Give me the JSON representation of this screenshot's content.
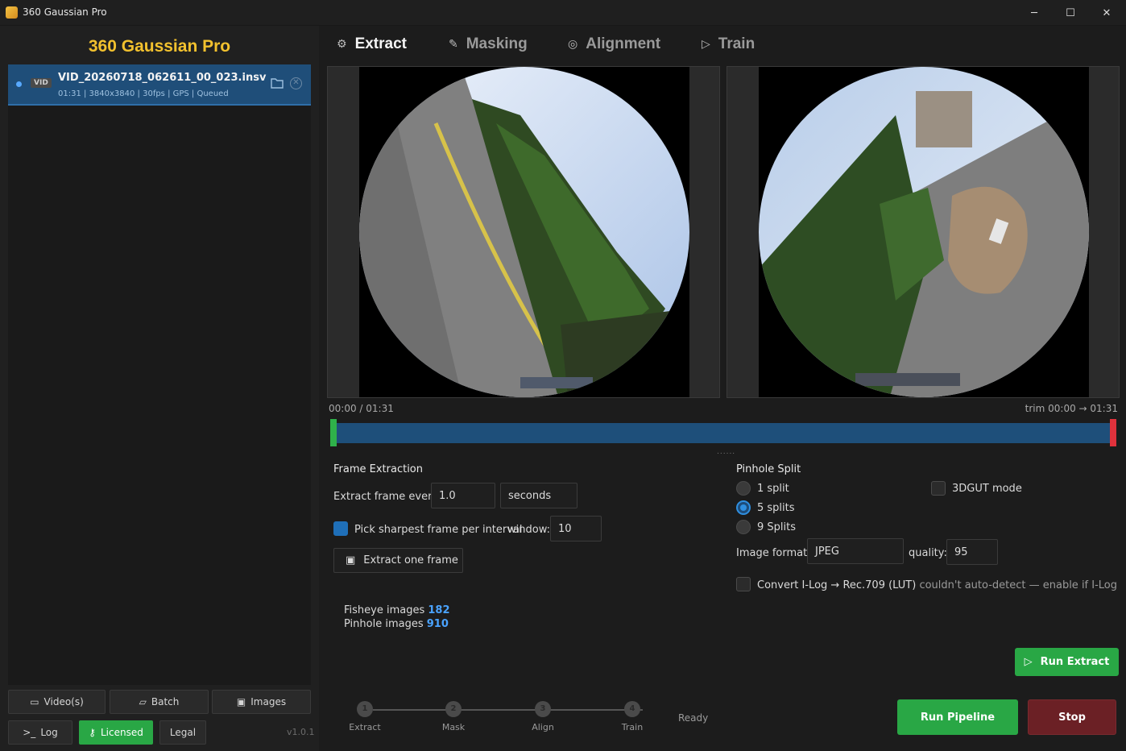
{
  "window": {
    "title": "360 Gaussian Pro",
    "minimize": "─",
    "maximize": "☐",
    "close": "✕"
  },
  "sidebar": {
    "brand": "360 Gaussian Pro",
    "files": [
      {
        "badge": "VID",
        "name": "VID_20260718_062611_00_023.insv",
        "meta": "01:31 | 3840x3840 | 30fps | GPS | Queued"
      }
    ],
    "buttons": {
      "videos": "Video(s)",
      "batch": "Batch",
      "images": "Images",
      "log": "Log",
      "licensed": "Licensed",
      "legal": "Legal"
    },
    "version": "v1.0.1"
  },
  "tabs": [
    {
      "label": "Extract",
      "icon": "gear-icon"
    },
    {
      "label": "Masking",
      "icon": "brush-icon"
    },
    {
      "label": "Alignment",
      "icon": "target-icon"
    },
    {
      "label": "Train",
      "icon": "play-icon"
    }
  ],
  "timeline": {
    "position": "00:00 / 01:31",
    "trim": "trim 00:00 → 01:31",
    "trim_start": 0.0,
    "trim_end": 1.0
  },
  "frame_extraction": {
    "title": "Frame Extraction",
    "every_label": "Extract frame every:",
    "every_value": "1.0",
    "unit": "seconds",
    "sharpest_label": "Pick sharpest frame per interval",
    "sharpest_checked": true,
    "window_label": "window:",
    "window_value": "10",
    "extract_one": "Extract one frame"
  },
  "stats": {
    "fisheye_label": "Fisheye images",
    "fisheye_count": "182",
    "pinhole_label": "Pinhole images",
    "pinhole_count": "910"
  },
  "pinhole_split": {
    "title": "Pinhole Split",
    "options": [
      {
        "label": "1 split",
        "checked": false
      },
      {
        "label": "5 splits",
        "checked": true
      },
      {
        "label": "9 Splits",
        "checked": false
      }
    ],
    "gut_label": "3DGUT mode",
    "format_label": "Image format:",
    "format_value": "JPEG",
    "quality_label": "quality:",
    "quality_value": "95",
    "ilog_label": "Convert I-Log → Rec.709 (LUT)",
    "ilog_hint": "couldn't auto-detect — enable if I-Log"
  },
  "actions": {
    "run_extract": "Run Extract",
    "run_pipeline": "Run Pipeline",
    "stop": "Stop"
  },
  "pipeline": {
    "steps": [
      {
        "num": "1",
        "label": "Extract"
      },
      {
        "num": "2",
        "label": "Mask"
      },
      {
        "num": "3",
        "label": "Align"
      },
      {
        "num": "4",
        "label": "Train"
      }
    ],
    "status": "Ready"
  },
  "colors": {
    "accent": "#29a745",
    "brand": "#f2c12e",
    "selection": "#1f4e79",
    "stop": "#6b2025"
  }
}
